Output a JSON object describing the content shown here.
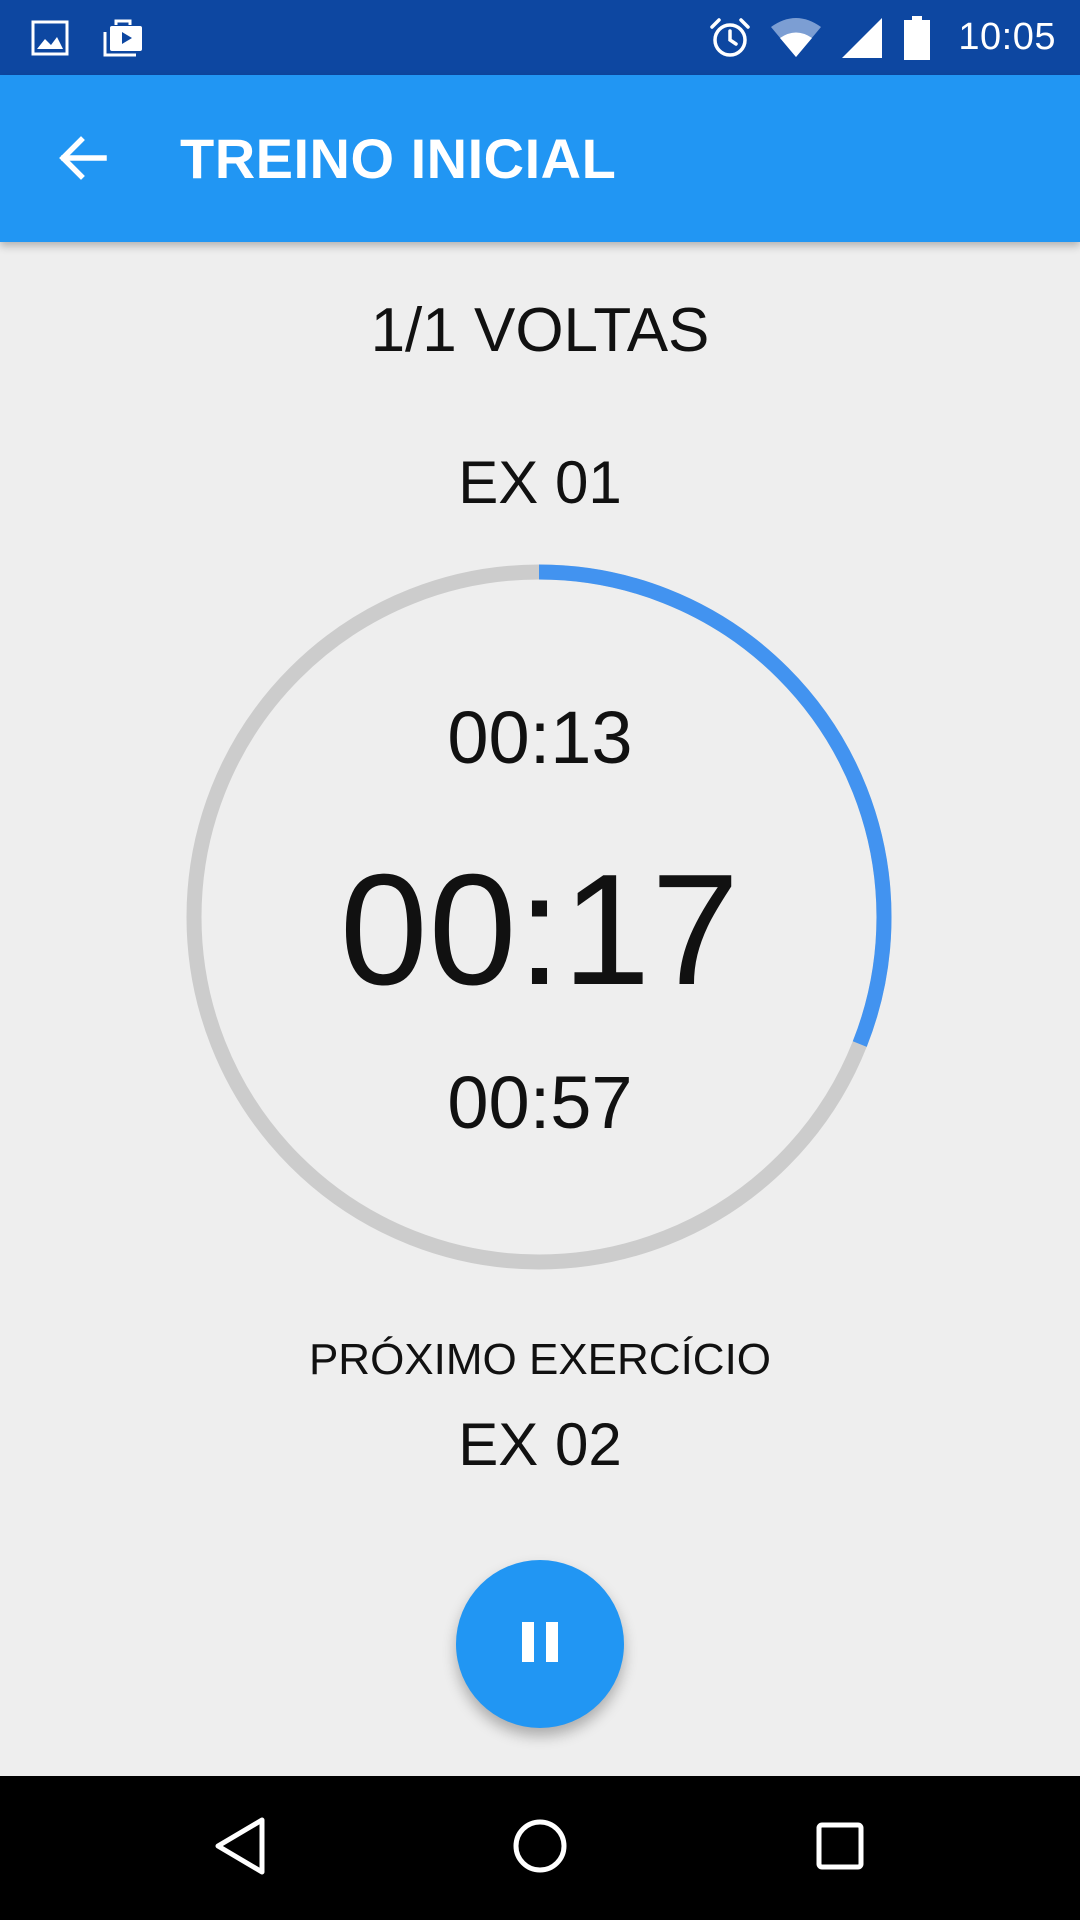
{
  "status_bar": {
    "time": "10:05",
    "icons": [
      "image-icon",
      "shop-bag-icon",
      "alarm-icon",
      "wifi-icon",
      "signal-icon",
      "battery-icon"
    ]
  },
  "app_bar": {
    "title": "TREINO INICIAL",
    "back_icon": "arrow-back-icon",
    "background_color": "#2196f3"
  },
  "workout": {
    "laps": "1/1 VOLTAS",
    "current_exercise": "EX 01",
    "elapsed_time": "00:13",
    "main_time": "00:17",
    "remaining_time": "00:57",
    "progress_fraction": 0.31,
    "progress_color": "#4293f0",
    "track_color": "#cccccc"
  },
  "next": {
    "label": "PRÓXIMO EXERCÍCIO",
    "exercise": "EX 02"
  },
  "fab": {
    "icon": "pause-icon",
    "color": "#2196f3"
  },
  "nav_bar": {
    "icons": [
      "nav-back-icon",
      "nav-home-icon",
      "nav-recents-icon"
    ]
  }
}
